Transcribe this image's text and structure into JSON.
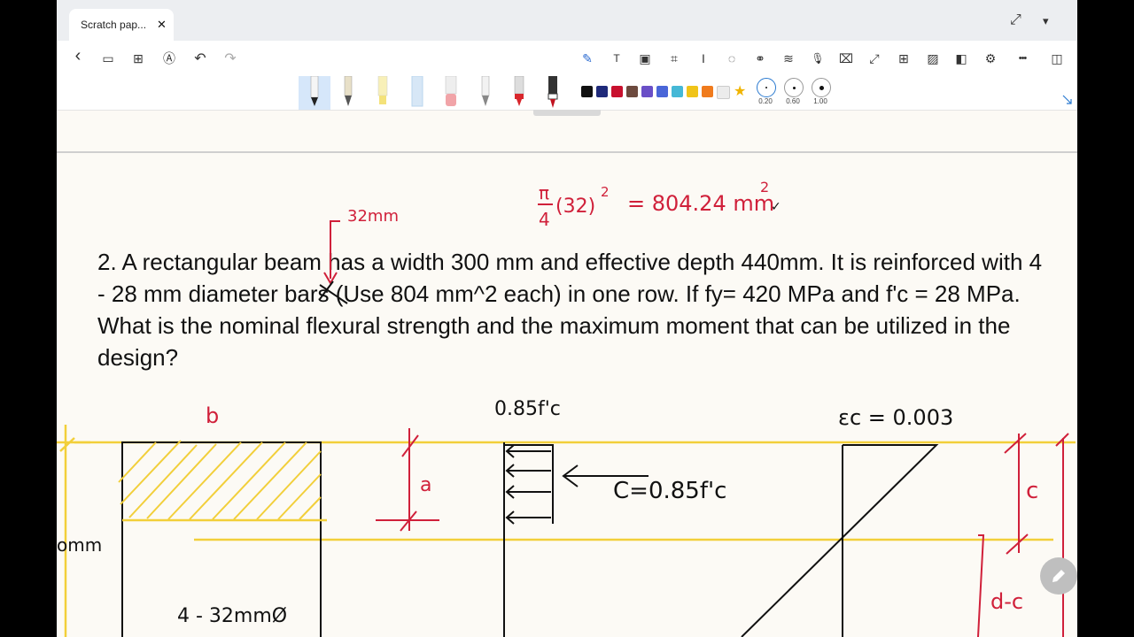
{
  "tab": {
    "title": "Scratch pap...",
    "close": "✕"
  },
  "window": {
    "expand": "⤢",
    "menu": "▾"
  },
  "toolbar": {
    "left": [
      {
        "name": "back-icon",
        "glyph": "‹"
      },
      {
        "name": "reading-mode-icon",
        "glyph": "▭"
      },
      {
        "name": "grid-view-icon",
        "glyph": "⊞"
      },
      {
        "name": "pen-mode-icon",
        "glyph": "Ⓐ"
      },
      {
        "name": "undo-icon",
        "glyph": "↶"
      },
      {
        "name": "redo-icon",
        "glyph": "↷"
      }
    ],
    "right": [
      {
        "name": "pen-tool-icon",
        "glyph": "✎"
      },
      {
        "name": "text-box-icon",
        "glyph": "T"
      },
      {
        "name": "insert-image-icon",
        "glyph": "▣"
      },
      {
        "name": "crop-icon",
        "glyph": "⌗"
      },
      {
        "name": "text-cursor-icon",
        "glyph": "I"
      },
      {
        "name": "comment-icon",
        "glyph": "◌"
      },
      {
        "name": "link-icon",
        "glyph": "⚭"
      },
      {
        "name": "layers-icon",
        "glyph": "≋"
      },
      {
        "name": "microphone-icon",
        "glyph": "🎙"
      },
      {
        "name": "ocr-icon",
        "glyph": "⌧"
      },
      {
        "name": "fullscreen-icon",
        "glyph": "⤢"
      },
      {
        "name": "add-page-icon",
        "glyph": "⊞"
      },
      {
        "name": "pattern-icon",
        "glyph": "▨"
      },
      {
        "name": "split-view-icon",
        "glyph": "◧"
      },
      {
        "name": "settings-icon",
        "glyph": "⚙"
      },
      {
        "name": "more-icon",
        "glyph": "•••"
      },
      {
        "name": "sidebar-toggle-icon",
        "glyph": "◫"
      }
    ]
  },
  "pens": [
    {
      "name": "fountain-pen",
      "color": "#111111",
      "selected": true
    },
    {
      "name": "pencil",
      "color": "#333333",
      "selected": false
    },
    {
      "name": "highlighter-yellow",
      "color": "#f4e27a",
      "selected": false
    },
    {
      "name": "texture-brush",
      "color": "#b8d4ee",
      "selected": false
    },
    {
      "name": "eraser",
      "color": "#f1a4a8",
      "selected": false
    },
    {
      "name": "lasso-pen",
      "color": "#888888",
      "selected": false
    },
    {
      "name": "marker-red",
      "color": "#d8262c",
      "selected": false
    },
    {
      "name": "laser-pen",
      "color": "#c1121f",
      "selected": false
    }
  ],
  "palette": [
    "#111111",
    "#1f2a7a",
    "#c8102e",
    "#6d4a3e",
    "#6a4fc7",
    "#4a66d8",
    "#45b8d6",
    "#f0c419",
    "#f07b1d",
    "#ececec"
  ],
  "favorite": "★",
  "widths": [
    {
      "label": "0.20",
      "selected": true
    },
    {
      "label": "0.60",
      "selected": false
    },
    {
      "label": "1.00",
      "selected": false
    }
  ],
  "problem": {
    "text": "2.   A rectangular beam has a width 300 mm and effective depth 440mm. It is reinforced with 4 - 28 mm diameter bars (Use 804 mm^2 each) in one row. If fy= 420 MPa and f'c = 28 MPa. What is the nominal flexural strength and the maximum moment that can be utilized in the design?"
  },
  "annotations": {
    "bar_size": "32mm",
    "area_calc": "= 804.24 mm",
    "area_pi": "π",
    "area_four": "4",
    "area_paren": "(32)",
    "exp": "2",
    "check": "✓",
    "b": "b",
    "a": "a",
    "stress": "0.85f'c",
    "compression": "C=0.85f'c",
    "strain": "εc = 0.003",
    "c": "c",
    "d_minus_c": "d-c",
    "depth": "omm",
    "bars": "4 - 32mmØ"
  },
  "colors": {
    "ink_red": "#d0203a",
    "ink_black": "#111111",
    "highlight": "#f2cf3a"
  }
}
